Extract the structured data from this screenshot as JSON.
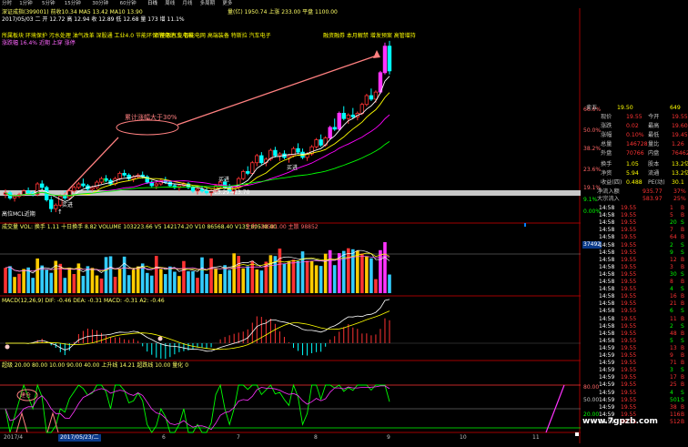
{
  "toolbar": {
    "tabs": [
      "分时",
      "1分钟",
      "5分钟",
      "15分钟",
      "30分钟",
      "60分钟",
      "日线",
      "周线",
      "月线",
      "多周期",
      "更多"
    ],
    "active_tab": "日线"
  },
  "main_chart": {
    "info_line_1": "深证成指(399001)  前收10.34  MA5 13.42  MA10 13.90",
    "info_line_2": "2017/05/03 二  开 12.72  高 12.94  收 12.89  低 12.68  量 173  增 11.1%",
    "concept_line": "所属板块  环境保护 污水处理 油气改革 深股通 工业4.0 节能环保 锂电池 充电桩",
    "concept_line_2": "新能源汽车 智能电网 高端装备 特斯拉 汽车电子",
    "status_line": "涨跌幅 16.4%  近期 上穿  涨停",
    "top_right_info": "量(亿) 1950.74  上涨 233.00  平盘 1100.00",
    "callout_top_right": "融资融券 本月解禁 增发预案 高管增持",
    "callout_label": "累计涨幅大于30%",
    "label_buy_1": "买进",
    "label_buy_2": "买进",
    "label_low": "13.29→13.70",
    "label_btm_left": "高位MCL近期"
  },
  "volume_panel": {
    "info": "成交量  VOL: 换手 1.11 十日换手 8.82  VOLUME 103223.66  V5 142174.20  V10 86568.40  V135 80538.00",
    "info_right": "主力 -10581.00  主散 98852",
    "axis_value": "37492",
    "axis_10000": "10000"
  },
  "macd_panel": {
    "info": "MACD(12,26,9)  DIF: -0.46  DEA: -0.31  MACD: -0.31  A2: -0.46"
  },
  "kdj_panel": {
    "info": "超级  20.00  80.00  10.00  90.00  40.00  上升线 14.21  超跌线 10.00  量化 0",
    "label_circle": "建仓",
    "axis_top": "80.00",
    "axis_mid": "50.00",
    "axis_bot": "20.00"
  },
  "date_axis": {
    "date_1": "2017/4",
    "date_2": "2017/05/23/二",
    "date_3": "6",
    "date_4": "7",
    "date_5": "8",
    "date_6": "9",
    "date_7": "10",
    "date_8": "11"
  },
  "price_axis": {
    "p1": "66.6%",
    "p2": "50.0%",
    "p3": "38.2%",
    "p4": "23.6%",
    "p5": "19.1%",
    "p6": "9.1%",
    "p7": "0.00%",
    "p8": "20.4%",
    "p9": "15.8%",
    "p10": "11.9%"
  },
  "right_panel": {
    "sell1_label": "卖五",
    "sell1_price": "19.50",
    "sell1_vol": "649",
    "quote_rows": [
      {
        "label": "现价",
        "value": "19.55",
        "label2": "今开",
        "value2": "19.55"
      },
      {
        "label": "涨跌",
        "value": "0.02",
        "label2": "最高",
        "value2": "19.60"
      },
      {
        "label": "涨幅",
        "value": "0.10%",
        "label2": "最低",
        "value2": "19.45"
      },
      {
        "label": "总量",
        "value": "146728",
        "label2": "量比",
        "value2": "1.26"
      },
      {
        "label": "外盘",
        "value": "70766",
        "label2": "内盘",
        "value2": "76462"
      }
    ],
    "finance_rows": [
      {
        "label": "换手",
        "value": "1.05",
        "label2": "股本",
        "value2": "13.2亿"
      },
      {
        "label": "净资",
        "value": "5.94",
        "label2": "流通",
        "value2": "13.2亿"
      },
      {
        "label": "收益(四)",
        "value": "0.488",
        "label2": "PE(动)",
        "value2": "30.1"
      }
    ],
    "net_label": "净流入额",
    "net_value": "935.77",
    "net_value2": "37%",
    "big_label": "大宗流入",
    "big_value": "583.97",
    "big_value2": "25%",
    "ticks": [
      {
        "time": "14:58",
        "price": "19.55",
        "vol": "1",
        "flag": "B"
      },
      {
        "time": "14:58",
        "price": "19.55",
        "vol": "5",
        "flag": "B"
      },
      {
        "time": "14:58",
        "price": "19.55",
        "vol": "20",
        "flag": "S"
      },
      {
        "time": "14:58",
        "price": "19.55",
        "vol": "7",
        "flag": "B"
      },
      {
        "time": "14:58",
        "price": "19.55",
        "vol": "64",
        "flag": "B"
      },
      {
        "time": "14:58",
        "price": "19.55",
        "vol": "2",
        "flag": "S"
      },
      {
        "time": "14:58",
        "price": "19.55",
        "vol": "9",
        "flag": "S"
      },
      {
        "time": "14:58",
        "price": "19.55",
        "vol": "12",
        "flag": "B"
      },
      {
        "time": "14:58",
        "price": "19.55",
        "vol": "3",
        "flag": "B"
      },
      {
        "time": "14:58",
        "price": "19.55",
        "vol": "30",
        "flag": "S"
      },
      {
        "time": "14:58",
        "price": "19.55",
        "vol": "8",
        "flag": "B"
      },
      {
        "time": "14:58",
        "price": "19.55",
        "vol": "4",
        "flag": "S"
      },
      {
        "time": "14:58",
        "price": "19.55",
        "vol": "16",
        "flag": "B"
      },
      {
        "time": "14:58",
        "price": "19.55",
        "vol": "21",
        "flag": "B"
      },
      {
        "time": "14:58",
        "price": "19.55",
        "vol": "6",
        "flag": "S"
      },
      {
        "time": "14:58",
        "price": "19.55",
        "vol": "11",
        "flag": "B"
      },
      {
        "time": "14:58",
        "price": "19.55",
        "vol": "2",
        "flag": "S"
      },
      {
        "time": "14:58",
        "price": "19.55",
        "vol": "48",
        "flag": "B"
      },
      {
        "time": "14:58",
        "price": "19.55",
        "vol": "5",
        "flag": "S"
      },
      {
        "time": "14:59",
        "price": "19.55",
        "vol": "13",
        "flag": "B"
      },
      {
        "time": "14:59",
        "price": "19.55",
        "vol": "9",
        "flag": "B"
      },
      {
        "time": "14:59",
        "price": "19.55",
        "vol": "71",
        "flag": "B"
      },
      {
        "time": "14:59",
        "price": "19.55",
        "vol": "3",
        "flag": "S"
      },
      {
        "time": "14:59",
        "price": "19.55",
        "vol": "17",
        "flag": "B"
      },
      {
        "time": "14:59",
        "price": "19.55",
        "vol": "25",
        "flag": "B"
      },
      {
        "time": "14:59",
        "price": "19.55",
        "vol": "4",
        "flag": "S"
      },
      {
        "time": "14:59",
        "price": "19.55",
        "vol": "501",
        "flag": "S"
      },
      {
        "time": "14:59",
        "price": "19.55",
        "vol": "38",
        "flag": "B"
      },
      {
        "time": "14:59",
        "price": "19.55",
        "vol": "116",
        "flag": "B"
      },
      {
        "time": "14:59",
        "price": "19.55",
        "vol": "512",
        "flag": "B"
      }
    ]
  },
  "watermark": "www.7gpzb.com",
  "colors": {
    "up": "#ff3333",
    "down": "#00ffff",
    "ma5": "#ffffff",
    "ma10": "#ffff00",
    "ma20": "#ff00ff",
    "ma60": "#00ff00",
    "annotation": "#ff8080",
    "blue_label": "#00a0ff"
  },
  "chart_data": {
    "type": "candlestick",
    "y_range": [
      11.5,
      21.5
    ],
    "candles": [
      [
        12.6,
        12.9,
        12.4,
        12.7
      ],
      [
        12.7,
        12.8,
        12.3,
        12.4
      ],
      [
        12.4,
        12.6,
        12.2,
        12.5
      ],
      [
        12.5,
        12.7,
        12.4,
        12.6
      ],
      [
        12.6,
        12.9,
        12.5,
        12.8
      ],
      [
        12.8,
        13.0,
        12.6,
        12.7
      ],
      [
        12.7,
        12.8,
        12.5,
        12.6
      ],
      [
        12.6,
        13.3,
        12.5,
        13.2
      ],
      [
        13.2,
        13.4,
        12.9,
        13.0
      ],
      [
        13.0,
        13.1,
        12.2,
        12.3
      ],
      [
        12.3,
        12.5,
        11.6,
        11.8
      ],
      [
        11.8,
        12.1,
        11.6,
        12.0
      ],
      [
        12.0,
        12.6,
        11.9,
        12.5
      ],
      [
        12.5,
        12.8,
        12.3,
        12.4
      ],
      [
        12.4,
        12.9,
        12.3,
        12.8
      ],
      [
        12.8,
        13.1,
        12.7,
        13.0
      ],
      [
        13.0,
        13.3,
        12.9,
        13.2
      ],
      [
        13.2,
        13.5,
        13.0,
        13.1
      ],
      [
        13.1,
        13.2,
        12.8,
        12.9
      ],
      [
        12.9,
        13.1,
        12.8,
        13.0
      ],
      [
        13.0,
        13.4,
        12.9,
        13.3
      ],
      [
        13.3,
        13.6,
        13.2,
        13.5
      ],
      [
        13.5,
        13.7,
        13.3,
        13.4
      ],
      [
        13.4,
        13.5,
        13.1,
        13.2
      ],
      [
        13.2,
        13.6,
        13.1,
        13.5
      ],
      [
        13.5,
        13.9,
        13.4,
        13.8
      ],
      [
        13.8,
        14.0,
        13.6,
        13.7
      ],
      [
        13.7,
        13.8,
        13.4,
        13.5
      ],
      [
        13.5,
        13.7,
        13.3,
        13.6
      ],
      [
        13.6,
        13.8,
        13.5,
        13.7
      ],
      [
        13.7,
        13.9,
        13.5,
        13.6
      ],
      [
        13.6,
        13.7,
        13.2,
        13.3
      ],
      [
        13.3,
        13.4,
        13.0,
        13.1
      ],
      [
        13.1,
        13.3,
        12.9,
        13.2
      ],
      [
        13.2,
        13.5,
        13.1,
        13.4
      ],
      [
        13.4,
        13.6,
        13.2,
        13.3
      ],
      [
        13.3,
        13.4,
        13.0,
        13.1
      ],
      [
        13.1,
        13.2,
        12.9,
        13.0
      ],
      [
        13.0,
        13.2,
        12.8,
        13.1
      ],
      [
        13.1,
        13.3,
        13.0,
        13.2
      ],
      [
        13.2,
        13.3,
        12.9,
        13.0
      ],
      [
        13.0,
        13.1,
        12.7,
        12.8
      ],
      [
        12.8,
        13.0,
        12.6,
        12.9
      ],
      [
        12.9,
        13.1,
        12.7,
        12.8
      ],
      [
        12.8,
        13.0,
        12.6,
        12.7
      ],
      [
        12.7,
        12.9,
        12.5,
        12.8
      ],
      [
        12.8,
        13.2,
        12.7,
        13.1
      ],
      [
        13.1,
        13.4,
        13.0,
        13.3
      ],
      [
        13.3,
        13.5,
        12.9,
        13.0
      ],
      [
        13.0,
        13.2,
        12.7,
        12.8
      ],
      [
        12.8,
        13.1,
        12.6,
        13.0
      ],
      [
        13.0,
        13.6,
        12.9,
        13.5
      ],
      [
        13.5,
        14.0,
        13.4,
        13.9
      ],
      [
        13.9,
        14.2,
        13.7,
        13.8
      ],
      [
        13.8,
        14.5,
        13.7,
        14.4
      ],
      [
        14.4,
        14.9,
        14.2,
        14.8
      ],
      [
        14.8,
        15.0,
        14.3,
        14.4
      ],
      [
        14.4,
        14.7,
        14.2,
        14.6
      ],
      [
        14.6,
        15.2,
        14.5,
        15.1
      ],
      [
        15.1,
        15.3,
        14.7,
        14.8
      ],
      [
        14.8,
        15.0,
        14.5,
        14.9
      ],
      [
        14.9,
        15.1,
        14.6,
        14.7
      ],
      [
        14.7,
        14.9,
        14.4,
        14.8
      ],
      [
        14.8,
        15.3,
        14.7,
        15.2
      ],
      [
        15.2,
        15.5,
        14.9,
        15.0
      ],
      [
        15.0,
        15.2,
        14.6,
        14.7
      ],
      [
        14.7,
        15.0,
        14.5,
        14.9
      ],
      [
        14.9,
        15.4,
        14.8,
        15.3
      ],
      [
        15.3,
        15.8,
        15.2,
        15.7
      ],
      [
        15.7,
        16.0,
        15.3,
        15.4
      ],
      [
        15.4,
        15.9,
        15.3,
        15.8
      ],
      [
        15.8,
        16.5,
        15.7,
        16.4
      ],
      [
        16.4,
        16.9,
        16.2,
        16.3
      ],
      [
        16.3,
        17.3,
        16.2,
        17.2
      ],
      [
        17.2,
        17.6,
        16.8,
        16.9
      ],
      [
        16.9,
        17.2,
        16.6,
        17.1
      ],
      [
        17.1,
        17.5,
        16.9,
        17.0
      ],
      [
        17.0,
        17.3,
        16.8,
        17.2
      ],
      [
        17.2,
        17.8,
        17.1,
        17.7
      ],
      [
        17.7,
        18.3,
        17.6,
        18.2
      ],
      [
        18.2,
        18.6,
        17.9,
        18.0
      ],
      [
        18.0,
        18.5,
        17.8,
        18.4
      ],
      [
        18.4,
        19.6,
        18.3,
        19.5
      ],
      [
        19.5,
        21.2,
        19.4,
        21.0
      ],
      [
        21.0,
        21.3,
        19.4,
        19.6
      ]
    ]
  }
}
